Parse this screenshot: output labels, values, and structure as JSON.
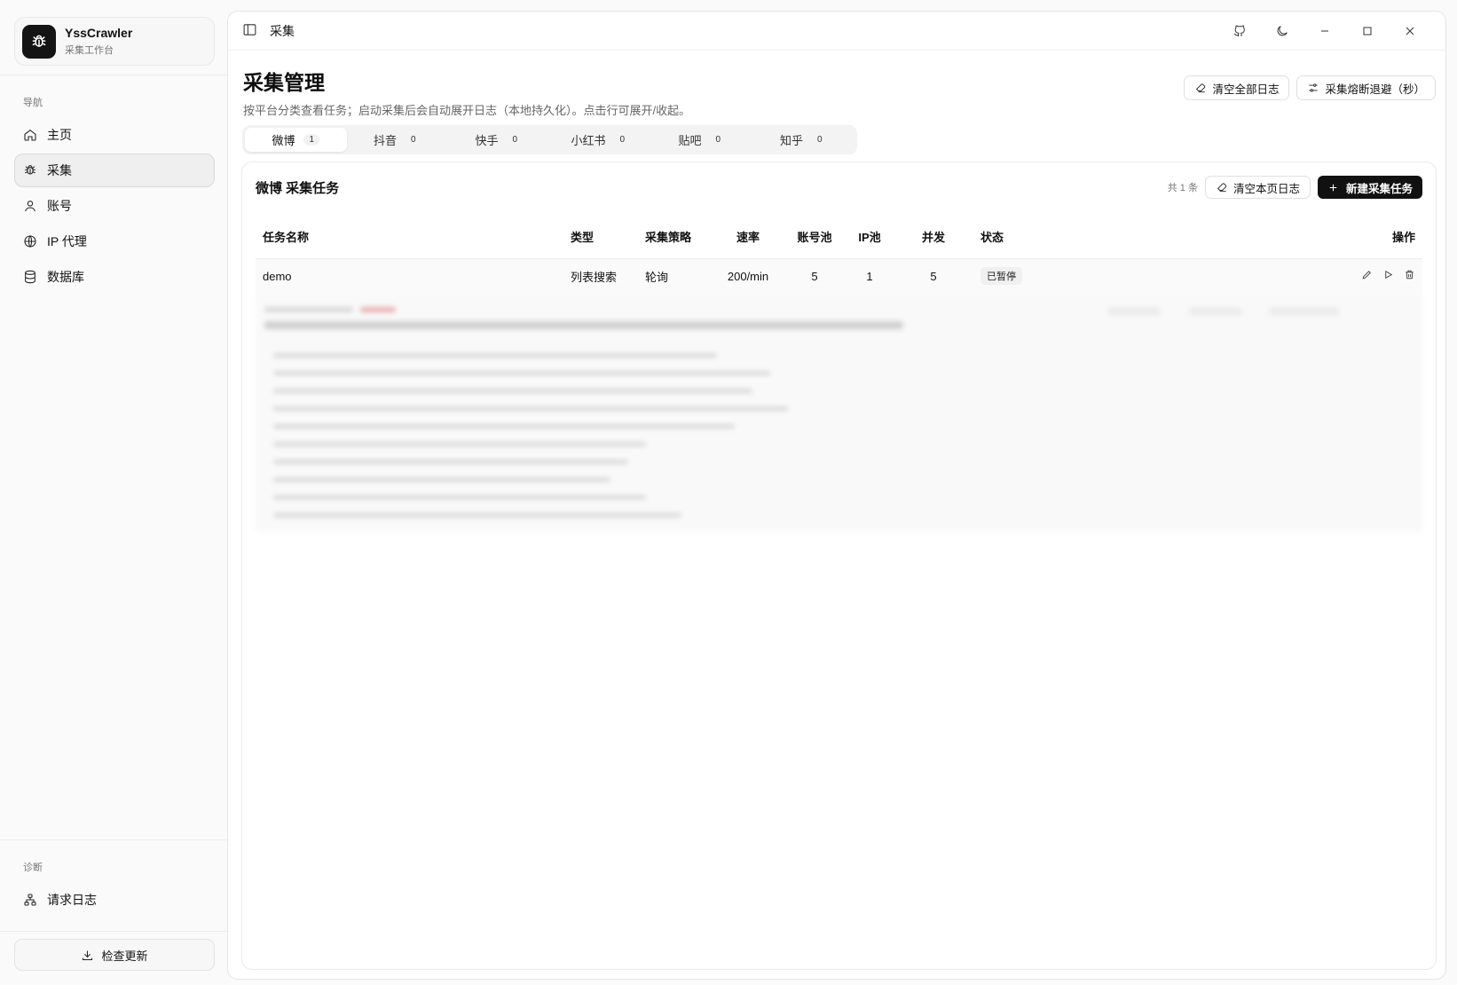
{
  "brand": {
    "name": "YssCrawler",
    "subtitle": "采集工作台"
  },
  "nav": {
    "heading": "导航",
    "items": [
      {
        "label": "主页",
        "icon": "home-icon"
      },
      {
        "label": "采集",
        "icon": "bug-icon"
      },
      {
        "label": "账号",
        "icon": "user-icon"
      },
      {
        "label": "IP 代理",
        "icon": "globe-icon"
      },
      {
        "label": "数据库",
        "icon": "database-icon"
      }
    ],
    "diag_heading": "诊断",
    "diag_items": [
      {
        "label": "请求日志",
        "icon": "network-icon"
      }
    ],
    "update_label": "检查更新"
  },
  "topbar": {
    "breadcrumb": "采集"
  },
  "page": {
    "title": "采集管理",
    "description": "按平台分类查看任务；启动采集后会自动展开日志（本地持久化）。点击行可展开/收起。",
    "clear_all_logs": "清空全部日志",
    "circuit_breaker": "采集熔断退避（秒）"
  },
  "tabs": [
    {
      "label": "微博",
      "count": "1"
    },
    {
      "label": "抖音",
      "count": "0"
    },
    {
      "label": "快手",
      "count": "0"
    },
    {
      "label": "小红书",
      "count": "0"
    },
    {
      "label": "贴吧",
      "count": "0"
    },
    {
      "label": "知乎",
      "count": "0"
    }
  ],
  "card": {
    "title": "微博 采集任务",
    "total": "共 1 条",
    "clear_page_logs": "清空本页日志",
    "new_task": "新建采集任务"
  },
  "table": {
    "columns": [
      "任务名称",
      "类型",
      "采集策略",
      "速率",
      "账号池",
      "IP池",
      "并发",
      "状态",
      "操作"
    ],
    "rows": [
      {
        "name": "demo",
        "type": "列表搜索",
        "strategy": "轮询",
        "rate": "200/min",
        "accounts": "5",
        "ips": "1",
        "concurrency": "5",
        "status": "已暂停"
      }
    ]
  },
  "colors": {
    "accent": "#111111",
    "background": "#fafafa",
    "active_nav": "#efefef"
  }
}
